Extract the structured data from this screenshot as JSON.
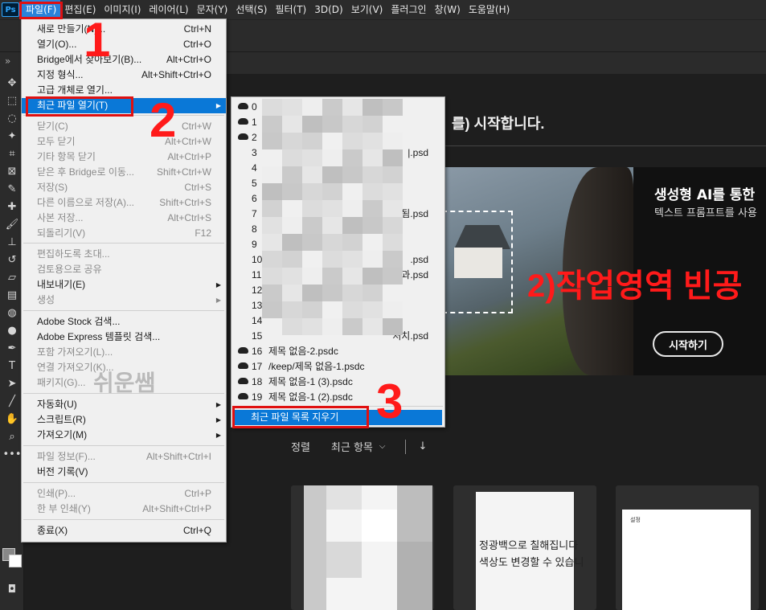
{
  "app": {
    "logo": "Ps"
  },
  "menubar": [
    "파일(F)",
    "편집(E)",
    "이미지(I)",
    "레이어(L)",
    "문자(Y)",
    "선택(S)",
    "필터(T)",
    "3D(D)",
    "보기(V)",
    "플러그인",
    "창(W)",
    "도움말(H)"
  ],
  "file_menu": [
    {
      "label": "새로 만들기(N)...",
      "shortcut": "Ctrl+N",
      "state": "enabled"
    },
    {
      "label": "열기(O)...",
      "shortcut": "Ctrl+O",
      "state": "enabled"
    },
    {
      "label": "Bridge에서 찾아보기(B)...",
      "shortcut": "Alt+Ctrl+O",
      "state": "enabled"
    },
    {
      "label": "지정 형식...",
      "shortcut": "Alt+Shift+Ctrl+O",
      "state": "enabled"
    },
    {
      "label": "고급 개체로 열기...",
      "shortcut": "",
      "state": "enabled"
    },
    {
      "label": "최근 파일 열기(T)",
      "shortcut": "",
      "state": "highlighted",
      "submenu": true
    },
    {
      "label": "닫기(C)",
      "shortcut": "Ctrl+W",
      "state": "disabled"
    },
    {
      "label": "모두 닫기",
      "shortcut": "Alt+Ctrl+W",
      "state": "disabled"
    },
    {
      "label": "기타 항목 닫기",
      "shortcut": "Alt+Ctrl+P",
      "state": "disabled"
    },
    {
      "label": "닫은 후 Bridge로 이동...",
      "shortcut": "Shift+Ctrl+W",
      "state": "disabled"
    },
    {
      "label": "저장(S)",
      "shortcut": "Ctrl+S",
      "state": "disabled"
    },
    {
      "label": "다른 이름으로 저장(A)...",
      "shortcut": "Shift+Ctrl+S",
      "state": "disabled"
    },
    {
      "label": "사본 저장...",
      "shortcut": "Alt+Ctrl+S",
      "state": "disabled"
    },
    {
      "label": "되돌리기(V)",
      "shortcut": "F12",
      "state": "disabled"
    },
    {
      "label": "편집하도록 초대...",
      "shortcut": "",
      "state": "disabled"
    },
    {
      "label": "검토용으로 공유",
      "shortcut": "",
      "state": "disabled"
    },
    {
      "label": "내보내기(E)",
      "shortcut": "",
      "state": "enabled",
      "submenu": true
    },
    {
      "label": "생성",
      "shortcut": "",
      "state": "disabled",
      "submenu": true
    },
    {
      "label": "Adobe Stock 검색...",
      "shortcut": "",
      "state": "enabled"
    },
    {
      "label": "Adobe Express 템플릿 검색...",
      "shortcut": "",
      "state": "enabled"
    },
    {
      "label": "포함 가져오기(L)...",
      "shortcut": "",
      "state": "disabled"
    },
    {
      "label": "연결 가져오기(K)...",
      "shortcut": "",
      "state": "disabled"
    },
    {
      "label": "패키지(G)...",
      "shortcut": "",
      "state": "disabled"
    },
    {
      "label": "자동화(U)",
      "shortcut": "",
      "state": "enabled",
      "submenu": true
    },
    {
      "label": "스크립트(R)",
      "shortcut": "",
      "state": "enabled",
      "submenu": true
    },
    {
      "label": "가져오기(M)",
      "shortcut": "",
      "state": "enabled",
      "submenu": true
    },
    {
      "label": "파일 정보(F)...",
      "shortcut": "Alt+Shift+Ctrl+I",
      "state": "disabled"
    },
    {
      "label": "버전 기록(V)",
      "shortcut": "",
      "state": "enabled"
    },
    {
      "label": "인쇄(P)...",
      "shortcut": "Ctrl+P",
      "state": "disabled"
    },
    {
      "label": "한 부 인쇄(Y)",
      "shortcut": "Alt+Shift+Ctrl+P",
      "state": "disabled"
    },
    {
      "label": "종료(X)",
      "shortcut": "Ctrl+Q",
      "state": "enabled"
    }
  ],
  "recent_files": [
    {
      "num": "0",
      "name": "",
      "cloud": true
    },
    {
      "num": "1",
      "name": "",
      "cloud": true
    },
    {
      "num": "2",
      "name": "",
      "cloud": true
    },
    {
      "num": "3",
      "name": "|.psd",
      "cloud": false
    },
    {
      "num": "4",
      "name": "",
      "cloud": false
    },
    {
      "num": "5",
      "name": "",
      "cloud": false
    },
    {
      "num": "6",
      "name": "",
      "cloud": false
    },
    {
      "num": "7",
      "name": "됨.psd",
      "cloud": false
    },
    {
      "num": "8",
      "name": "",
      "cloud": false
    },
    {
      "num": "9",
      "name": "",
      "cloud": false
    },
    {
      "num": "10",
      "name": ".psd",
      "cloud": false
    },
    {
      "num": "11",
      "name": "결과.psd",
      "cloud": false
    },
    {
      "num": "12",
      "name": "",
      "cloud": false
    },
    {
      "num": "13",
      "name": "",
      "cloud": false
    },
    {
      "num": "14",
      "name": "",
      "cloud": false
    },
    {
      "num": "15",
      "name": "처치.psd",
      "cloud": false
    },
    {
      "num": "16",
      "name": "제목 없음-2.psdc",
      "cloud": true
    },
    {
      "num": "17",
      "name": "/keep/제목 없음-1.psdc",
      "cloud": true
    },
    {
      "num": "18",
      "name": "제목 없음-1 (3).psdc",
      "cloud": true
    },
    {
      "num": "19",
      "name": "제목 없음-1 (2).psdc",
      "cloud": true
    }
  ],
  "clear_recent": "최근 파일 목록 지우기",
  "home": {
    "welcome": "를) 시작합니다.",
    "hero_title": "생성형 AI를 통한",
    "hero_sub": "텍스트 프롬프트를 사용",
    "hero_button": "시작하기",
    "sort_label": "정렬",
    "sort_value": "최근 항목",
    "thumb2_text_line1": "정광백으로 칠해집니다",
    "thumb2_text_line2": "색상도 변경할 수 있습니",
    "thumb3_title": "설정"
  },
  "annotations": {
    "n1": "1",
    "n2": "2",
    "n3": "3",
    "work_area": "2)작업영역 빈공"
  },
  "watermark": "쉬운쌤",
  "colors": {
    "highlight": "#0a78d7",
    "annotation": "#ff1a1a"
  }
}
